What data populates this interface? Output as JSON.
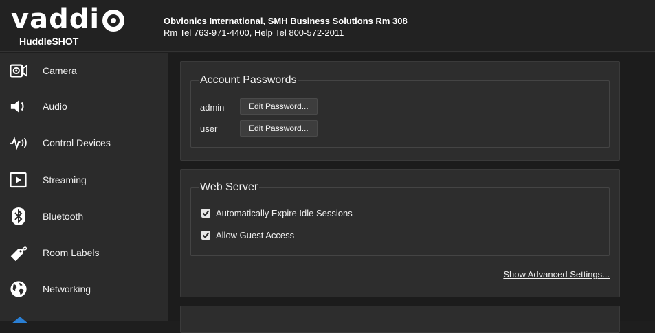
{
  "header": {
    "logo_text": "vaddio",
    "product": "HuddleSHOT",
    "location_line": "Obvionics International, SMH Business Solutions Rm 308",
    "phone_line": "Rm Tel 763-971-4400, Help Tel 800-572-2011"
  },
  "sidebar": {
    "items": [
      {
        "label": "Camera",
        "icon": "camera-icon"
      },
      {
        "label": "Audio",
        "icon": "speaker-icon"
      },
      {
        "label": "Control Devices",
        "icon": "control-signal-icon"
      },
      {
        "label": "Streaming",
        "icon": "play-icon"
      },
      {
        "label": "Bluetooth",
        "icon": "bluetooth-icon"
      },
      {
        "label": "Room Labels",
        "icon": "tag-icon"
      },
      {
        "label": "Networking",
        "icon": "globe-icon"
      }
    ]
  },
  "account_passwords": {
    "title": "Account Passwords",
    "users": [
      {
        "name": "admin",
        "button": "Edit Password..."
      },
      {
        "name": "user",
        "button": "Edit Password..."
      }
    ]
  },
  "web_server": {
    "title": "Web Server",
    "options": [
      {
        "label": "Automatically Expire Idle Sessions",
        "checked": true
      },
      {
        "label": "Allow Guest Access",
        "checked": true
      }
    ],
    "advanced_link": "Show Advanced Settings..."
  }
}
